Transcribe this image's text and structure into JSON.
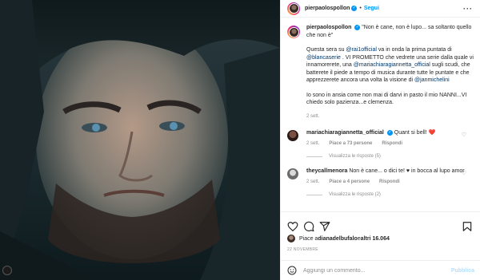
{
  "header": {
    "username": "pierpaolospollon",
    "dot": "•",
    "follow_label": "Segui",
    "more_label": "···"
  },
  "caption": {
    "username": "pierpaolospollon",
    "quote": "\"Non è cane, non è lupo... sa soltanto quello che non è\"",
    "p1_a": "Questa sera su ",
    "p1_m1": "@rai1official",
    "p1_b": " va in onda la prima puntata di ",
    "p1_m2": "@blancaserie",
    "p1_c": " . VI PROMETTO che vedrete una serie dalla quale vi innamorerete, una ",
    "p1_m3": "@mariachiaragiannetta_official",
    "p1_d": " sugli scudi, che batterete il piede a tempo di musica durante tutte le puntate e che apprezzerete ancora una volta la visione di ",
    "p1_m4": "@janmichelini",
    "p2": "Io sono in ansia come non mai di darvi in pasto il mio NANNI...VI chiedo solo pazienza...e clemenza.",
    "time": "2 sett."
  },
  "comments": [
    {
      "username": "mariachiaragiannetta_official",
      "text": "Quant si bell! ❤️",
      "time": "2 sett.",
      "likes": "Piace a 73 persone",
      "reply": "Rispondi",
      "view_replies": "Visualizza le risposte (5)"
    },
    {
      "username": "theycallmenora",
      "text": "Non è cane... o dici te! ♥ in bocca al lupo amor",
      "time": "2 sett.",
      "likes": "Piace a 4 persone",
      "reply": "Rispondi",
      "view_replies": "Visualizza le risposte (2)"
    }
  ],
  "likes_line": {
    "prefix": "Piace a ",
    "user": "dianadelbufalo",
    "suffix": " e ",
    "others": "altri 16.064"
  },
  "date": "22 NOVEMBRE",
  "add_comment": {
    "placeholder": "Aggiungi un commento...",
    "publish_label": "Pubblica"
  },
  "icons": {
    "like": "heart-icon",
    "comment": "comment-icon",
    "share": "share-icon",
    "save": "bookmark-icon",
    "emoji": "emoji-icon"
  },
  "colors": {
    "accent": "#0095f6",
    "heart": "#ed4956"
  }
}
